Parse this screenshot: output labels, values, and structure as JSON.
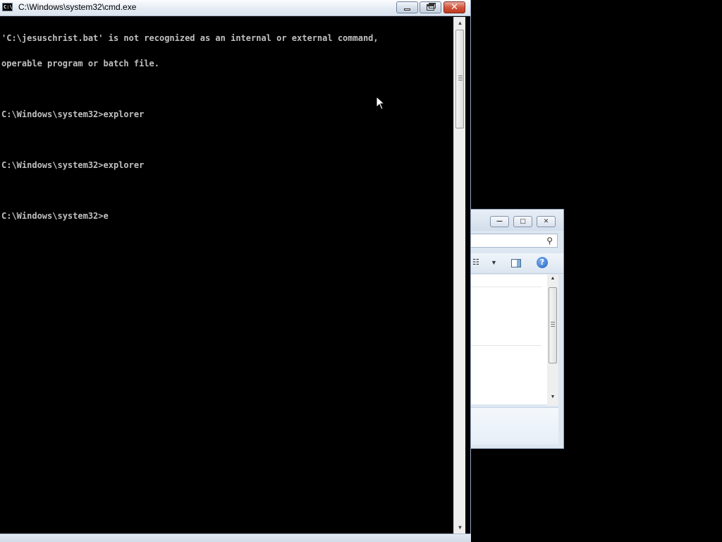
{
  "cmd_window": {
    "title": "C:\\Windows\\system32\\cmd.exe",
    "icon_text": "C:\\",
    "close_glyph": "✕",
    "console_lines": [
      "'C:\\jesuschrist.bat' is not recognized as an internal or external command,",
      "operable program or batch file.",
      "",
      "C:\\Windows\\system32>explorer",
      "",
      "C:\\Windows\\system32>explorer",
      "",
      "C:\\Windows\\system32>e"
    ],
    "scroll_position": 0.0
  },
  "explorer_window": {
    "minimize_glyph": "—",
    "maximize_glyph": "□",
    "close_glyph": "✕",
    "search_glyph": "⚲",
    "views_glyph": "☷",
    "caret_glyph": "▼",
    "help_glyph": "?"
  },
  "colors": {
    "console_bg": "#000000",
    "console_fg": "#c0c0c0",
    "close_button": "#c0391e"
  }
}
